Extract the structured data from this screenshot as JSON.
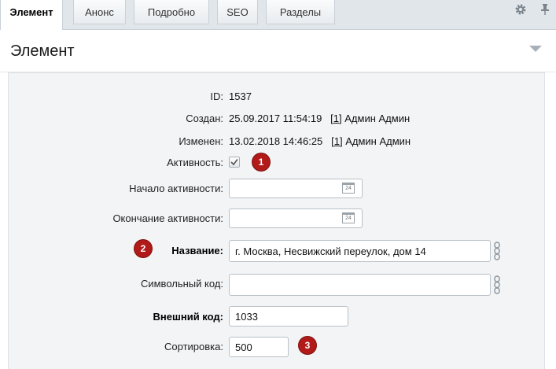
{
  "tabs": [
    {
      "label": "Элемент"
    },
    {
      "label": "Анонс"
    },
    {
      "label": "Подробно"
    },
    {
      "label": "SEO"
    },
    {
      "label": "Разделы"
    }
  ],
  "panel": {
    "title": "Элемент"
  },
  "fields": {
    "id": {
      "label": "ID:",
      "value": "1537"
    },
    "created": {
      "label": "Создан:",
      "date": "25.09.2017 11:54:19",
      "user_link": "1",
      "user_name": "Админ Админ"
    },
    "modified": {
      "label": "Изменен:",
      "date": "13.02.2018 14:46:25",
      "user_link": "1",
      "user_name": "Админ Админ"
    },
    "active": {
      "label": "Активность:",
      "checked": true
    },
    "active_from": {
      "label": "Начало активности:",
      "value": ""
    },
    "active_to": {
      "label": "Окончание активности:",
      "value": ""
    },
    "name": {
      "label": "Название:",
      "value": "г. Москва, Несвижский переулок, дом 14"
    },
    "code": {
      "label": "Символьный код:",
      "value": ""
    },
    "xml_id": {
      "label": "Внешний код:",
      "value": "1033"
    },
    "sort": {
      "label": "Сортировка:",
      "value": "500"
    }
  },
  "calendar_icon_text": "24",
  "badges": [
    "1",
    "2",
    "3"
  ],
  "colors": {
    "badge": "#b21a1a",
    "form_bg": "#f2f4f5",
    "tabbar_bg": "#e1e6ea"
  }
}
